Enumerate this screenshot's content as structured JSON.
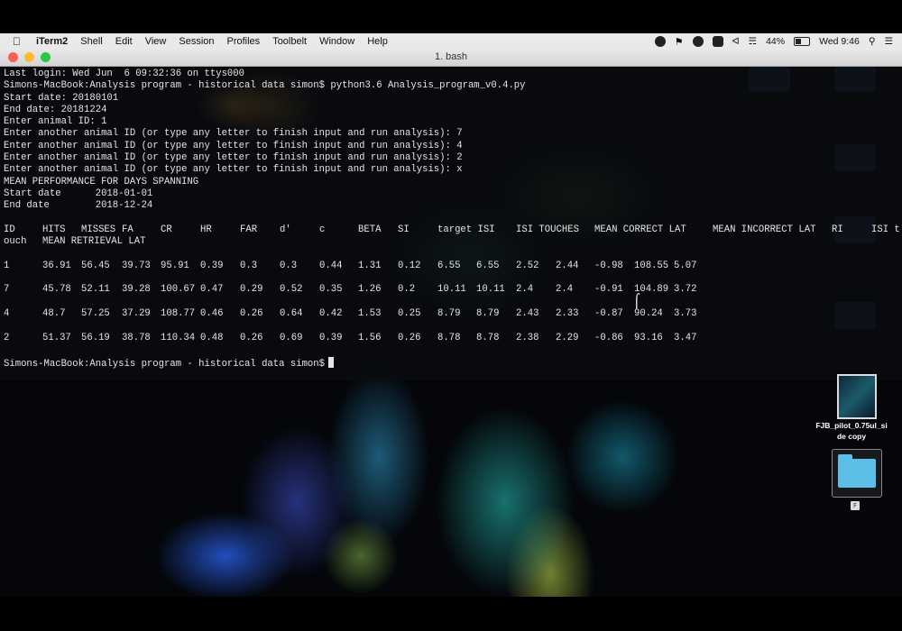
{
  "menubar": {
    "app_name": "iTerm2",
    "menus": [
      "Shell",
      "Edit",
      "View",
      "Session",
      "Profiles",
      "Toolbelt",
      "Window",
      "Help"
    ],
    "battery_text": "44%",
    "clock": "Wed 9:46"
  },
  "window": {
    "title": "1. bash"
  },
  "terminal": {
    "lines": [
      "Last login: Wed Jun  6 09:32:36 on ttys000",
      "Simons-MacBook:Analysis program - historical data simon$ python3.6 Analysis_program_v0.4.py",
      "Start date: 20180101",
      "End date: 20181224",
      "Enter animal ID: 1",
      "Enter another animal ID (or type any letter to finish input and run analysis): 7",
      "Enter another animal ID (or type any letter to finish input and run analysis): 4",
      "Enter another animal ID (or type any letter to finish input and run analysis): 2",
      "Enter another animal ID (or type any letter to finish input and run analysis): x",
      "MEAN PERFORMANCE FOR DAYS SPANNING",
      "Start date      2018-01-01",
      "End date        2018-12-24"
    ],
    "table_headers": [
      "ID",
      "HITS",
      "MISSES",
      "FA",
      "CR",
      "HR",
      "FAR",
      "d'",
      "c",
      "BETA",
      "SI",
      "target ISI",
      "ISI TOUCHES",
      "MEAN CORRECT LAT",
      "MEAN INCORRECT LAT",
      "RI",
      "ISI t"
    ],
    "table_headers_wrap": [
      "ouch",
      "MEAN RETRIEVAL LAT"
    ],
    "rows": [
      [
        "1",
        "36.91",
        "56.45",
        "39.73",
        "95.91",
        "0.39",
        "0.3",
        "0.3",
        "0.44",
        "1.31",
        "0.12",
        "6.55",
        "6.55",
        "2.52",
        "2.44",
        "-0.98",
        "108.55",
        "5.07"
      ],
      [
        "7",
        "45.78",
        "52.11",
        "39.28",
        "100.67",
        "0.47",
        "0.29",
        "0.52",
        "0.35",
        "1.26",
        "0.2",
        "10.11",
        "10.11",
        "2.4",
        "2.4",
        "-0.91",
        "104.89",
        "3.72"
      ],
      [
        "4",
        "48.7",
        "57.25",
        "37.29",
        "108.77",
        "0.46",
        "0.26",
        "0.64",
        "0.42",
        "1.53",
        "0.25",
        "8.79",
        "8.79",
        "2.43",
        "2.33",
        "-0.87",
        "90.24",
        "3.73"
      ],
      [
        "2",
        "51.37",
        "56.19",
        "38.78",
        "110.34",
        "0.48",
        "0.26",
        "0.69",
        "0.39",
        "1.56",
        "0.26",
        "8.78",
        "8.78",
        "2.38",
        "2.29",
        "-0.86",
        "93.16",
        "3.47"
      ]
    ],
    "prompt": "Simons-MacBook:Analysis program - historical data simon$"
  },
  "desktop": {
    "file_label_line1": "FJB_pilot_0.75ul_si",
    "file_label_line2": "de copy",
    "folder_tag": "F"
  }
}
